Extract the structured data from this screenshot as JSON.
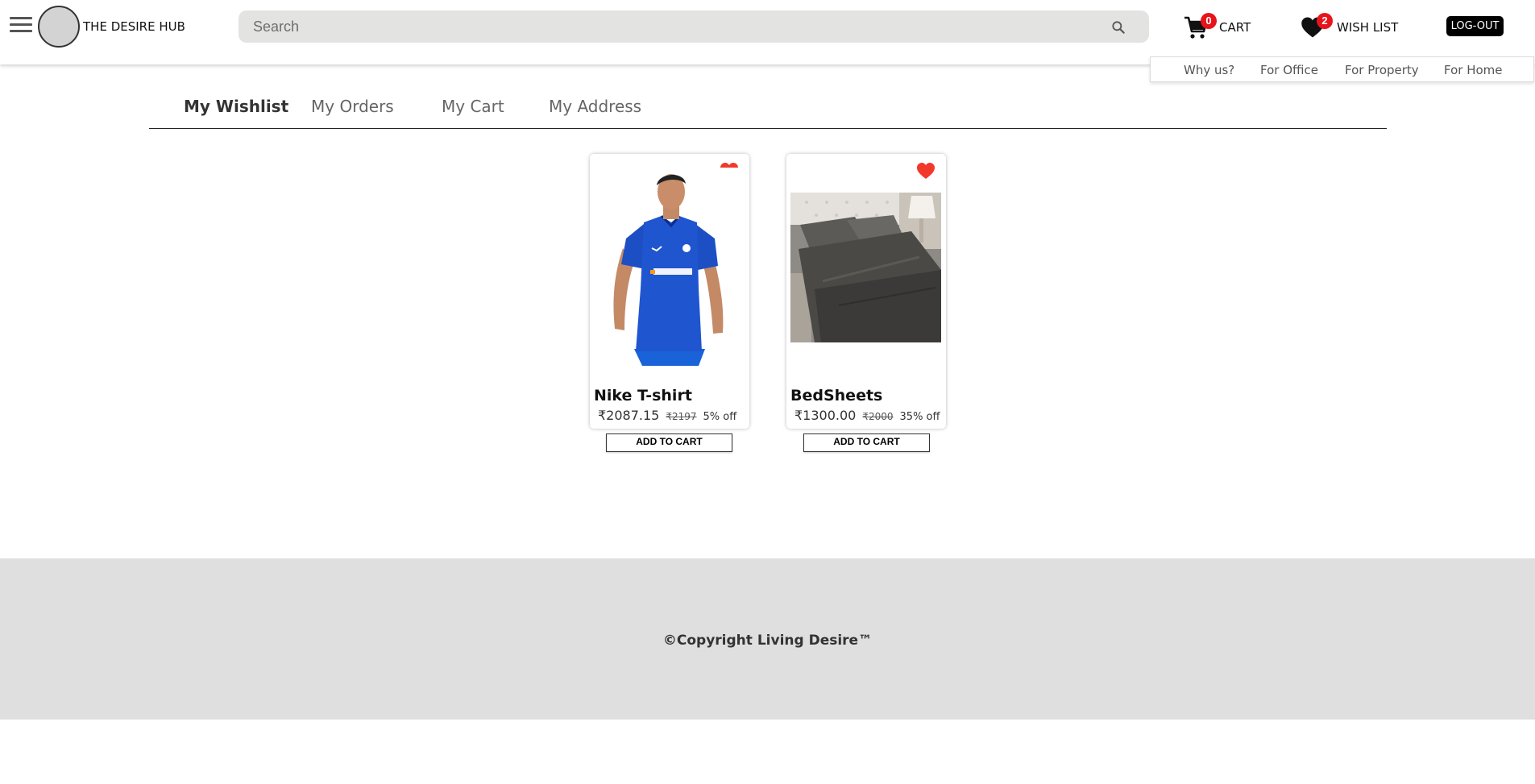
{
  "header": {
    "brand": "THE DESIRE HUB",
    "search_placeholder": "Search",
    "cart": {
      "label": "CART",
      "count": "0"
    },
    "wishlist": {
      "label": "WISH LIST",
      "count": "2"
    },
    "logout_label": "LOG-OUT"
  },
  "subnav": [
    "Why us?",
    "For Office",
    "For Property",
    "For Home"
  ],
  "tabs": [
    {
      "label": "My Wishlist",
      "active": true
    },
    {
      "label": "My Orders",
      "active": false
    },
    {
      "label": "My Cart",
      "active": false
    },
    {
      "label": "My Address",
      "active": false
    }
  ],
  "products": [
    {
      "name": "Nike T-shirt",
      "price": "₹2087.15",
      "mrp": "₹2197",
      "discount": "5% off",
      "button": "ADD TO CART",
      "image": "blue-football-jersey"
    },
    {
      "name": "BedSheets",
      "price": "₹1300.00",
      "mrp": "₹2000",
      "discount": "35% off",
      "button": "ADD TO CART",
      "image": "grey-bedsheets"
    }
  ],
  "footer": {
    "copyright": "©Copyright Living Desire™"
  },
  "colors": {
    "badge": "#e8141b",
    "heart": "#f2382a",
    "footer_bg": "#e0dfdf",
    "search_bg": "#e3e3e2"
  },
  "icons": [
    "menu-icon",
    "search-icon",
    "cart-icon",
    "heart-icon"
  ]
}
